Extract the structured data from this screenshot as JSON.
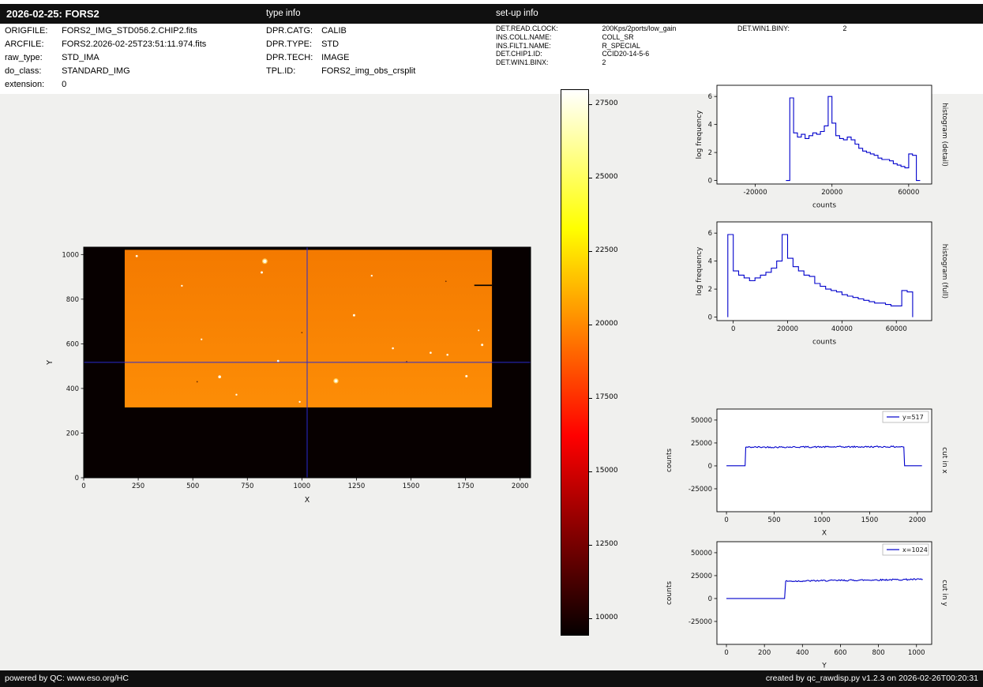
{
  "header": {
    "title": "2026-02-25: FORS2",
    "type_info_heading": "type info",
    "setup_info_heading": "set-up info"
  },
  "file_info": {
    "rows": [
      {
        "label": "ORIGFILE:",
        "value": "FORS2_IMG_STD056.2.CHIP2.fits"
      },
      {
        "label": "ARCFILE:",
        "value": "FORS2.2026-02-25T23:51:11.974.fits"
      },
      {
        "label": "raw_type:",
        "value": "STD_IMA"
      },
      {
        "label": "do_class:",
        "value": "STANDARD_IMG"
      },
      {
        "label": "extension:",
        "value": "0"
      }
    ]
  },
  "type_info": {
    "rows": [
      {
        "label": "DPR.CATG:",
        "value": "CALIB"
      },
      {
        "label": "DPR.TYPE:",
        "value": "STD"
      },
      {
        "label": "DPR.TECH:",
        "value": "IMAGE"
      },
      {
        "label": "TPL.ID:",
        "value": "FORS2_img_obs_crsplit"
      }
    ]
  },
  "setup_info": {
    "rows": [
      {
        "label": "DET.READ.CLOCK:",
        "value": "200Kps/2ports/low_gain"
      },
      {
        "label": "INS.COLL.NAME:",
        "value": "COLL_SR"
      },
      {
        "label": "INS.FILT1.NAME:",
        "value": "R_SPECIAL"
      },
      {
        "label": "DET.CHIP1.ID:",
        "value": "CCID20-14-5-6"
      },
      {
        "label": "DET.WIN1.BINX:",
        "value": "2"
      }
    ],
    "right_rows": [
      {
        "label": "DET.WIN1.BINY:",
        "value": "2"
      }
    ]
  },
  "footer": {
    "left": "powered by QC: www.eso.org/HC",
    "right": "created by qc_rawdisp.py v1.2.3 on 2026-02-26T00:20:31"
  },
  "chart_data": {
    "main_image": {
      "type": "heatmap",
      "xlabel": "X",
      "ylabel": "Y",
      "xlim": [
        0,
        2048
      ],
      "ylim": [
        0,
        1033
      ],
      "xticks": [
        0,
        250,
        500,
        750,
        1000,
        1250,
        1500,
        1750,
        2000
      ],
      "yticks": [
        0,
        200,
        400,
        600,
        800,
        1000
      ],
      "detector": {
        "x0": 0,
        "y0": 0,
        "x1": 2048,
        "y1": 1033,
        "color": "#070000"
      },
      "exposed": {
        "x0": 188,
        "y0": 315,
        "x1": 1871,
        "y1": 1021,
        "color_top": "#f47a00",
        "color_bottom": "#fd8d06",
        "mean_counts": 20000
      },
      "crosshair": {
        "x": 1024,
        "y": 517,
        "color": "#2a2ad0"
      },
      "streak": {
        "x0": 1790,
        "x1": 1871,
        "y": 862,
        "color": "#000000"
      },
      "stars": [
        [
          243,
          993,
          1.4
        ],
        [
          830,
          970,
          2.2
        ],
        [
          816,
          920,
          1.5
        ],
        [
          1239,
          728,
          1.5
        ],
        [
          1826,
          595,
          1.5
        ],
        [
          1590,
          560,
          1.3
        ],
        [
          1417,
          580,
          1.3
        ],
        [
          891,
          523,
          1.4
        ],
        [
          623,
          452,
          1.8
        ],
        [
          1156,
          434,
          2.0
        ],
        [
          1754,
          455,
          1.5
        ],
        [
          1667,
          551,
          1.3
        ],
        [
          700,
          372,
          1.2
        ],
        [
          990,
          340,
          1.2
        ],
        [
          450,
          860,
          1.2
        ],
        [
          1320,
          905,
          1.2
        ],
        [
          540,
          620,
          1.1
        ],
        [
          1810,
          660,
          1.0
        ]
      ],
      "dark_spots": [
        [
          520,
          430
        ],
        [
          1000,
          650
        ],
        [
          1480,
          520
        ],
        [
          1660,
          880
        ]
      ]
    },
    "colorbar": {
      "type": "colorbar",
      "colormap": "hot",
      "vmin": 9400,
      "vmax": 28000,
      "ticks": [
        10000,
        12500,
        15000,
        17500,
        20000,
        22500,
        25000,
        27500
      ],
      "gradient": [
        [
          0,
          "#050000"
        ],
        [
          0.365,
          "#ff0000"
        ],
        [
          0.746,
          "#ffff00"
        ],
        [
          1,
          "#ffffff"
        ]
      ]
    },
    "hist_detail": {
      "type": "line",
      "step": true,
      "xlabel": "counts",
      "ylabel": "log frequency",
      "right_label": "histogram (detail)",
      "xlim": [
        -40000,
        72000
      ],
      "ylim": [
        -0.25,
        6.8
      ],
      "xticks": [
        -20000,
        20000,
        60000
      ],
      "yticks": [
        0,
        2,
        4,
        6
      ],
      "line_color": "#0000cc",
      "bin_edges": [
        -4000,
        -2000,
        0,
        2000,
        4000,
        6000,
        8000,
        10000,
        12000,
        14000,
        16000,
        18000,
        20000,
        22000,
        24000,
        26000,
        28000,
        30000,
        32000,
        34000,
        36000,
        38000,
        40000,
        42000,
        44000,
        46000,
        48000,
        50000,
        52000,
        54000,
        56000,
        58000,
        60000,
        62000,
        64000,
        66000
      ],
      "log_freq": [
        0,
        5.9,
        3.4,
        3.1,
        3.3,
        3.0,
        3.2,
        3.4,
        3.3,
        3.5,
        3.9,
        6.0,
        4.1,
        3.2,
        3.0,
        2.9,
        3.1,
        2.9,
        2.6,
        2.3,
        2.1,
        2.0,
        1.9,
        1.8,
        1.6,
        1.5,
        1.5,
        1.4,
        1.2,
        1.1,
        1.0,
        0.9,
        1.9,
        1.8,
        0
      ]
    },
    "hist_full": {
      "type": "line",
      "step": true,
      "xlabel": "counts",
      "ylabel": "log frequency",
      "right_label": "histogram (full)",
      "xlim": [
        -6000,
        73000
      ],
      "ylim": [
        -0.25,
        6.8
      ],
      "xticks": [
        0,
        20000,
        40000,
        60000
      ],
      "yticks": [
        0,
        2,
        4,
        6
      ],
      "line_color": "#0000cc",
      "bin_edges": [
        -2000,
        0,
        2000,
        4000,
        6000,
        8000,
        10000,
        12000,
        14000,
        16000,
        18000,
        20000,
        22000,
        24000,
        26000,
        28000,
        30000,
        32000,
        34000,
        36000,
        38000,
        40000,
        42000,
        44000,
        46000,
        48000,
        50000,
        52000,
        54000,
        56000,
        58000,
        60000,
        62000,
        64000,
        66000
      ],
      "log_freq": [
        5.9,
        3.3,
        3.0,
        2.8,
        2.6,
        2.8,
        3.0,
        3.2,
        3.5,
        4.0,
        5.9,
        4.2,
        3.6,
        3.3,
        3.0,
        2.9,
        2.4,
        2.2,
        2.0,
        1.9,
        1.8,
        1.6,
        1.5,
        1.4,
        1.3,
        1.2,
        1.1,
        1.0,
        1.0,
        0.9,
        0.8,
        0.8,
        1.9,
        1.8
      ]
    },
    "cut_x": {
      "type": "line",
      "step": false,
      "xlabel": "X",
      "ylabel": "counts",
      "right_label": "cut in x",
      "legend": "y=517",
      "xlim": [
        -100,
        2150
      ],
      "ylim": [
        -50000,
        62000
      ],
      "xticks": [
        0,
        500,
        1000,
        1500,
        2000
      ],
      "yticks": [
        -25000,
        0,
        25000,
        50000
      ],
      "line_color": "#0000cc",
      "points": [
        [
          0,
          100
        ],
        [
          195,
          100
        ],
        [
          202,
          20400
        ],
        [
          1858,
          20900
        ],
        [
          1866,
          150
        ],
        [
          2048,
          150
        ]
      ],
      "noise": {
        "amp": 800,
        "from": 202,
        "to": 1858
      }
    },
    "cut_y": {
      "type": "line",
      "step": false,
      "xlabel": "Y",
      "ylabel": "counts",
      "right_label": "cut in y",
      "legend": "x=1024",
      "xlim": [
        -50,
        1080
      ],
      "ylim": [
        -50000,
        62000
      ],
      "xticks": [
        0,
        200,
        400,
        600,
        800,
        1000
      ],
      "yticks": [
        -25000,
        0,
        25000,
        50000
      ],
      "line_color": "#0000cc",
      "points": [
        [
          0,
          80
        ],
        [
          306,
          80
        ],
        [
          312,
          18900
        ],
        [
          1033,
          21000
        ]
      ],
      "noise": {
        "amp": 800,
        "from": 312,
        "to": 1033
      }
    }
  }
}
